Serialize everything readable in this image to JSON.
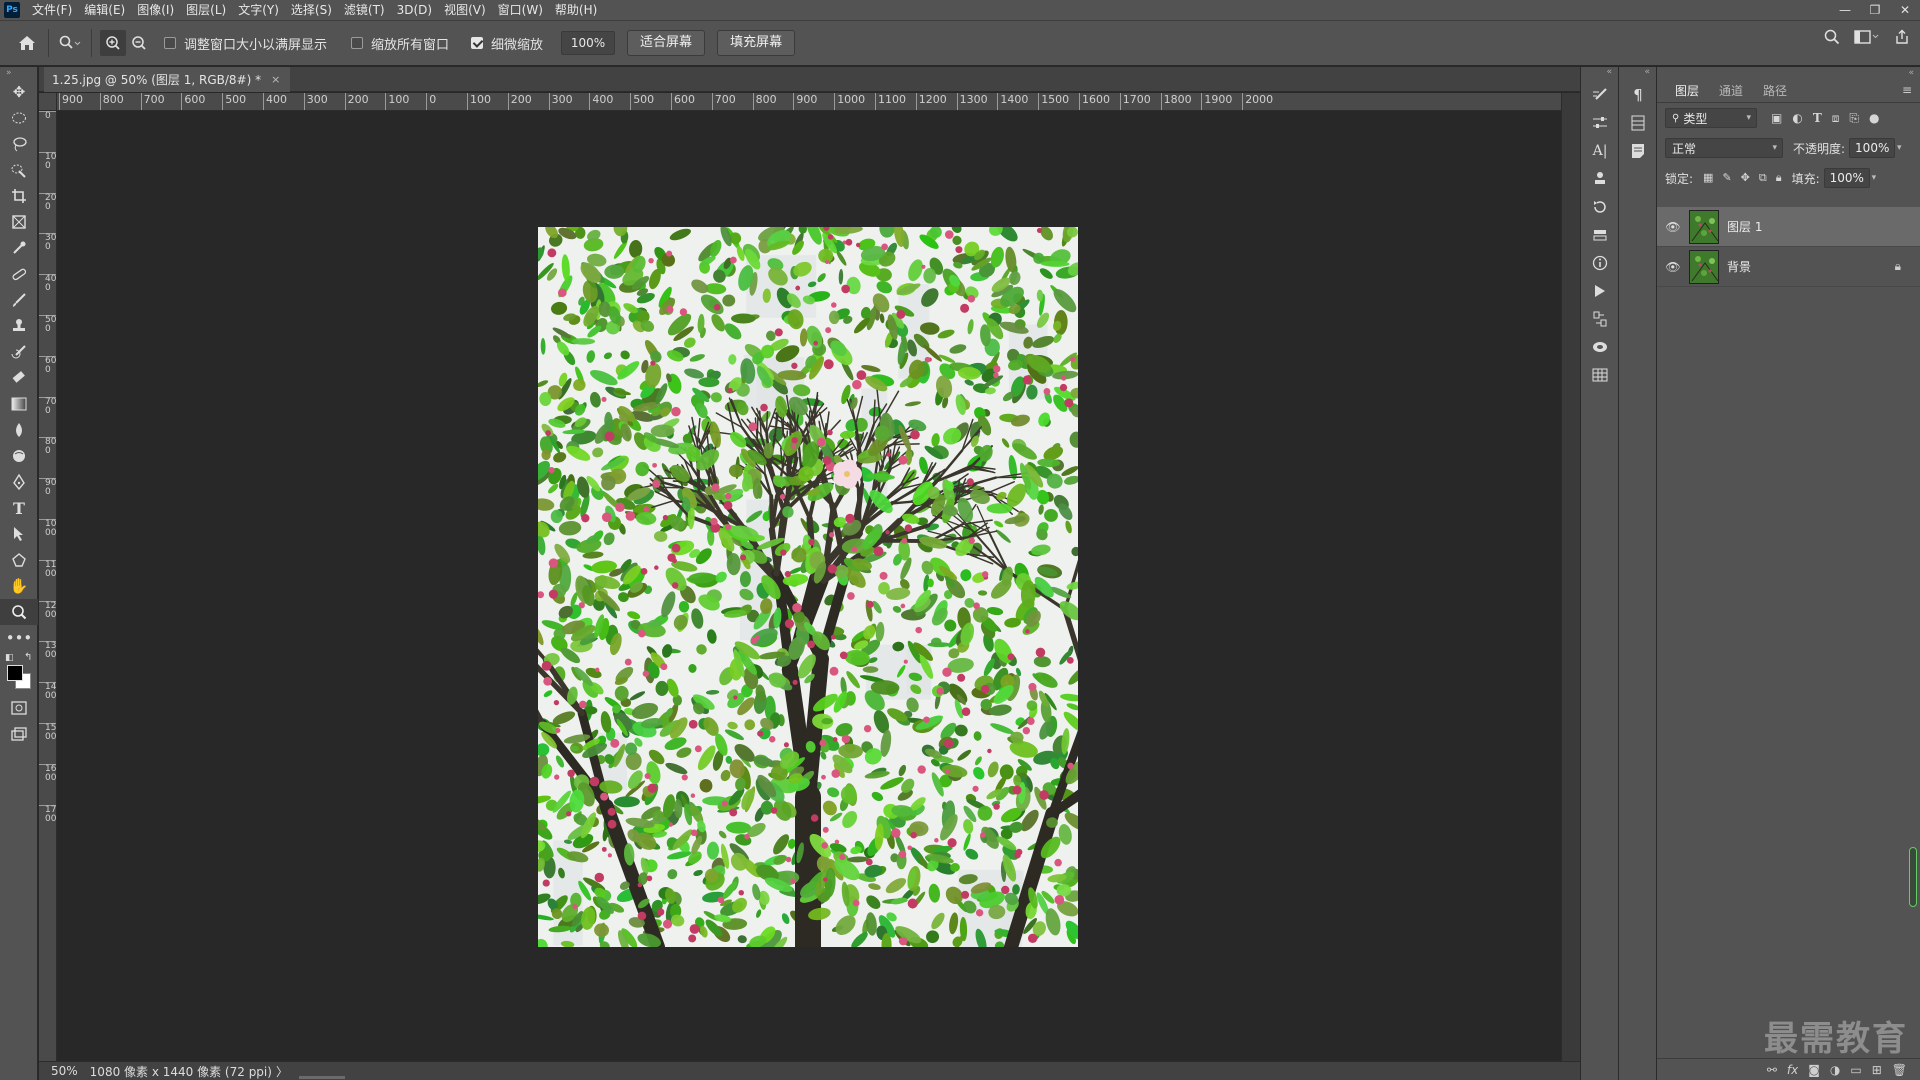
{
  "app": {
    "logo": "Ps"
  },
  "menu": [
    "文件(F)",
    "编辑(E)",
    "图像(I)",
    "图层(L)",
    "文字(Y)",
    "选择(S)",
    "滤镜(T)",
    "3D(D)",
    "视图(V)",
    "窗口(W)",
    "帮助(H)"
  ],
  "window_controls": {
    "minimize": "—",
    "restore": "❐",
    "close": "✕"
  },
  "options": {
    "resize_windows_label": "调整窗口大小以满屏显示",
    "resize_windows_checked": false,
    "zoom_all_label": "缩放所有窗口",
    "zoom_all_checked": false,
    "scrubby_zoom_label": "细微缩放",
    "scrubby_zoom_checked": true,
    "zoom_value": "100%",
    "fit_screen_label": "适合屏幕",
    "fill_screen_label": "填充屏幕"
  },
  "document": {
    "tab_title": "1.25.jpg @ 50% (图层 1, RGB/8#) *",
    "close_glyph": "×",
    "zoom_percent": "50%",
    "info": "1080 像素 x 1440 像素 (72 ppi)",
    "info_arrow": "〉"
  },
  "rulers": {
    "horizontal": [
      "900",
      "800",
      "700",
      "600",
      "500",
      "400",
      "300",
      "200",
      "100",
      "0",
      "100",
      "200",
      "300",
      "400",
      "500",
      "600",
      "700",
      "800",
      "900",
      "1000",
      "1100",
      "1200",
      "1300",
      "1400",
      "1500",
      "1600",
      "1700",
      "1800",
      "1900",
      "2000"
    ],
    "vertical": [
      "0",
      "1 0 0",
      "2 0 0",
      "3 0 0",
      "4 0 0",
      "5 0 0",
      "6 0 0",
      "7 0 0",
      "8 0 0",
      "9 0 0",
      "1 0 0 0",
      "1 1 0 0",
      "1 2 0 0",
      "1 3 0 0",
      "1 4 0 0",
      "1 5 0 0",
      "1 6 0 0",
      "1 7 0 0"
    ]
  },
  "layers_panel": {
    "tabs": [
      "图层",
      "通道",
      "路径"
    ],
    "active_tab": "图层",
    "filter_kind": "类型",
    "blend_mode": "正常",
    "opacity_label": "不透明度:",
    "opacity_value": "100%",
    "lock_label": "锁定:",
    "fill_label": "填充:",
    "fill_value": "100%",
    "layers": [
      {
        "name": "图层 1",
        "selected": true,
        "locked": false
      },
      {
        "name": "背景",
        "selected": false,
        "locked": true
      }
    ]
  },
  "watermark": "最需教育",
  "colors": {
    "accent": "#31a8ff",
    "ui_bg": "#535353",
    "canvas_bg": "#282828"
  }
}
